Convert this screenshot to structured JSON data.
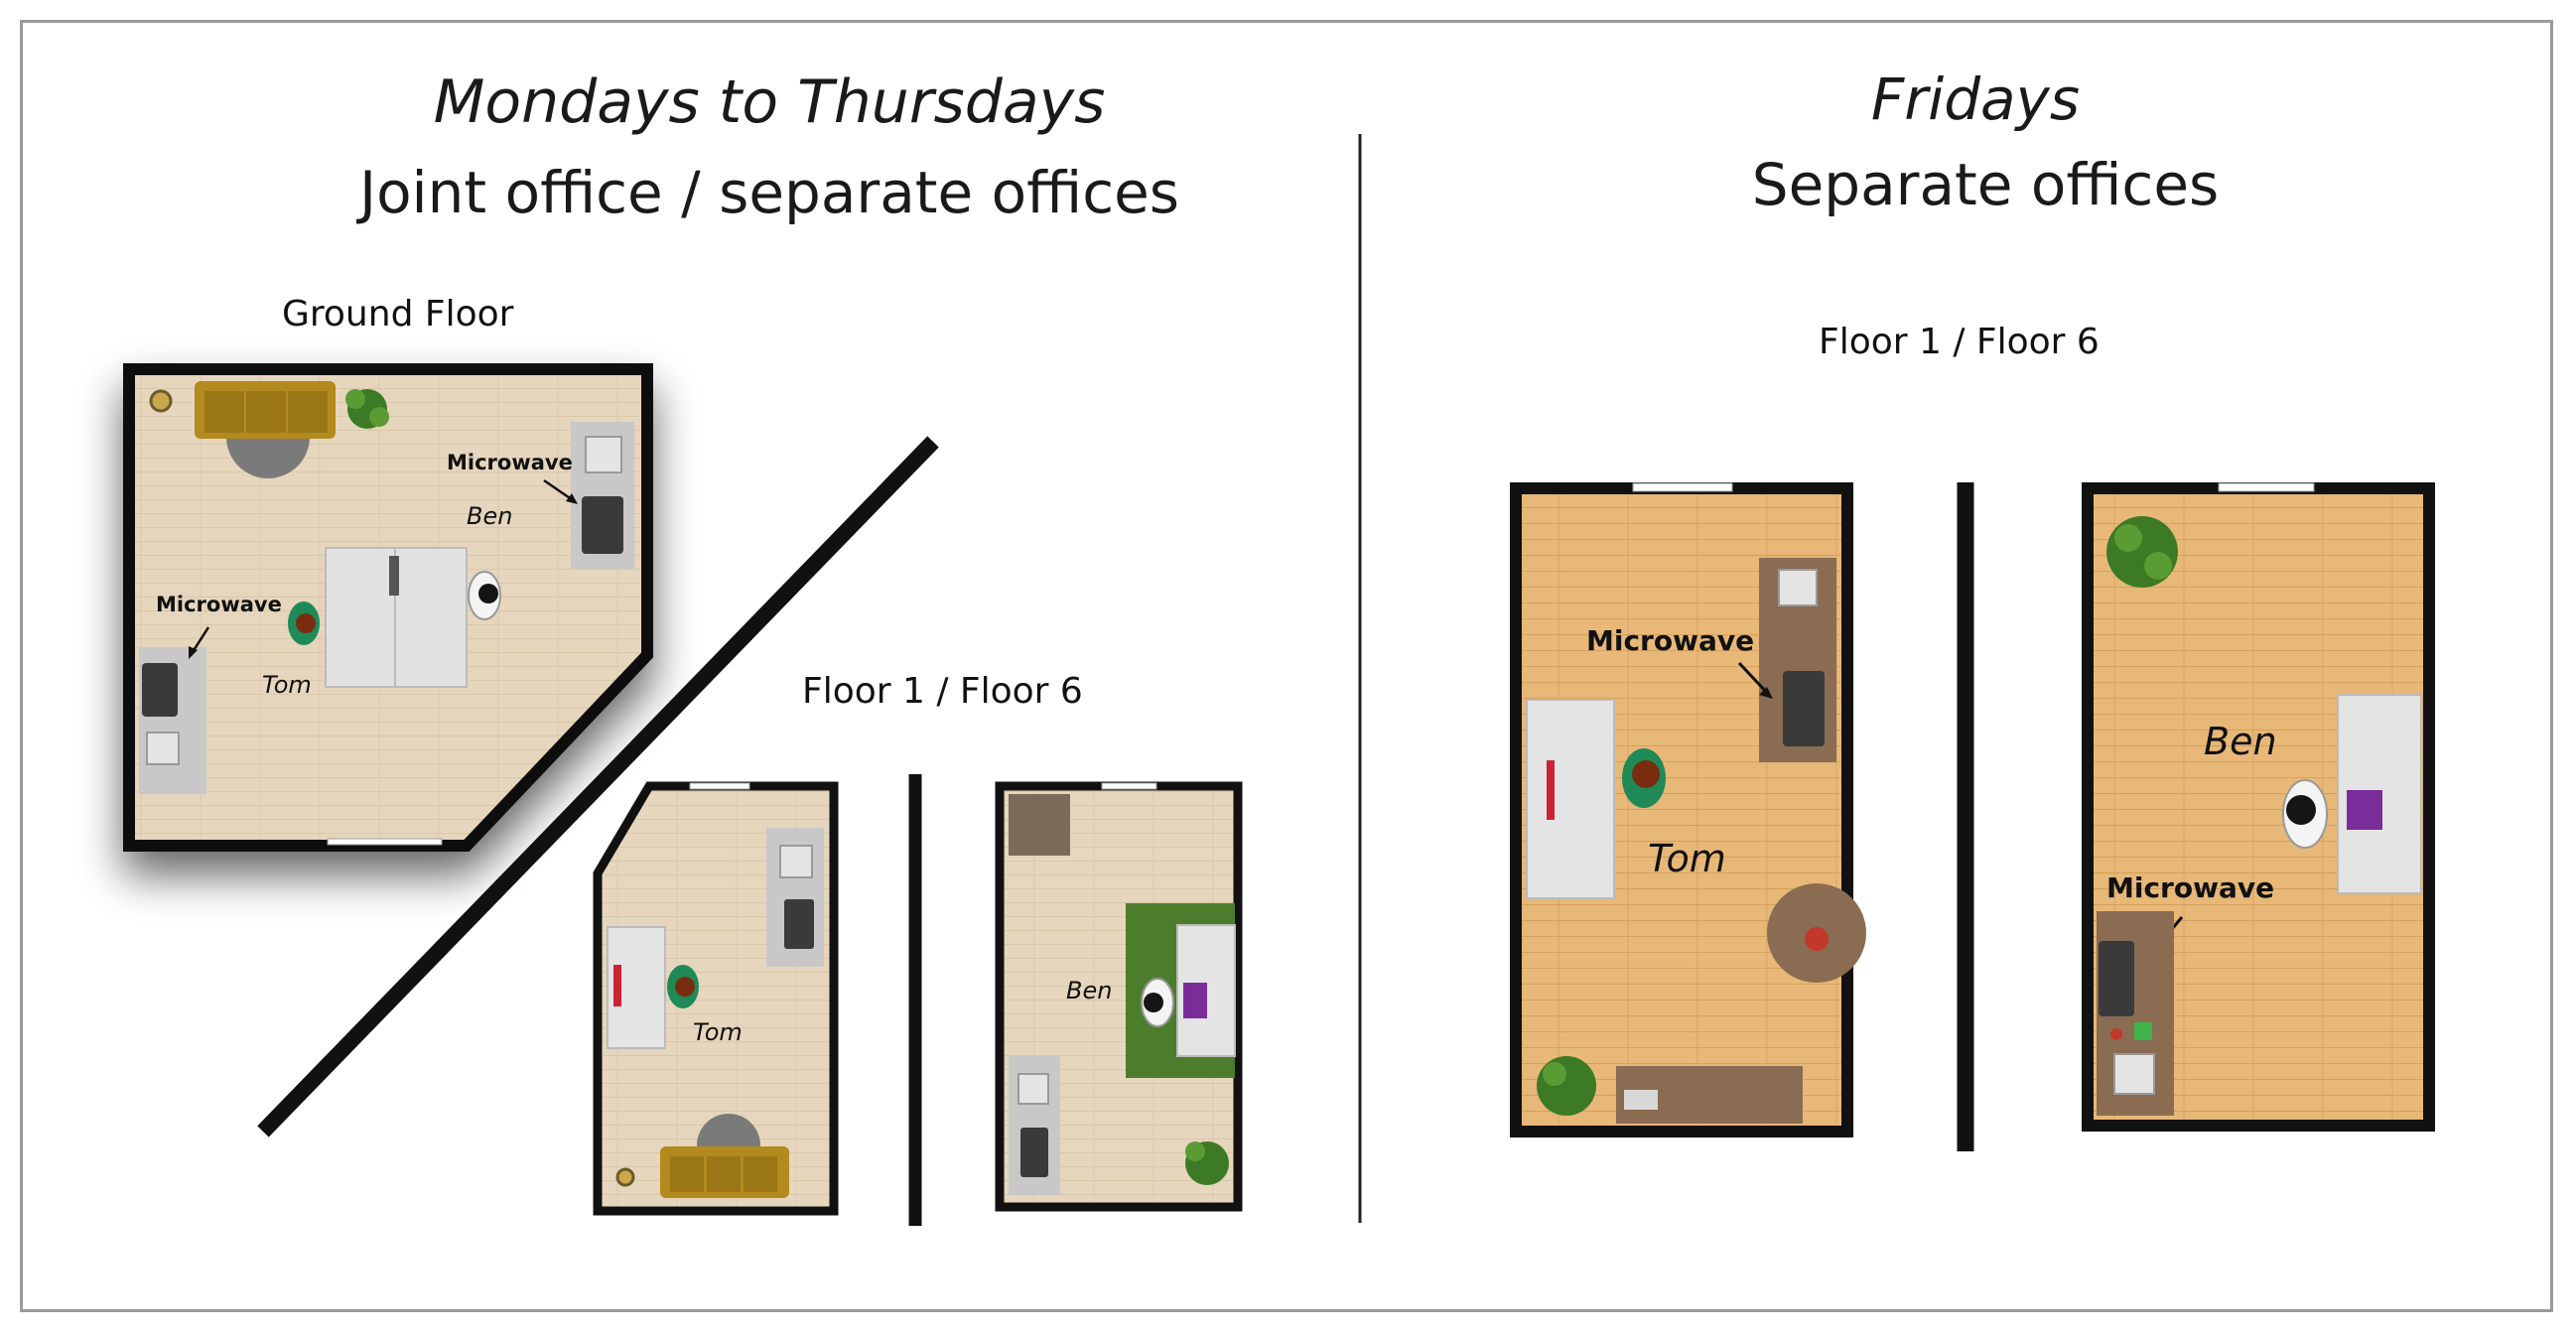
{
  "left_panel": {
    "schedule": "Mondays to Thursdays",
    "arrangement": "Joint office / separate offices",
    "ground_floor_label": "Ground Floor",
    "upper_floor_label": "Floor 1 / Floor 6",
    "ground_floor": {
      "microwave_right": "Microwave",
      "microwave_left": "Microwave",
      "person_ben": "Ben",
      "person_tom": "Tom"
    },
    "floor_tom": {
      "person": "Tom"
    },
    "floor_ben": {
      "person": "Ben"
    }
  },
  "right_panel": {
    "schedule": "Fridays",
    "arrangement": "Separate offices",
    "floor_label": "Floor 1 / Floor 6",
    "office_tom": {
      "microwave": "Microwave",
      "person": "Tom"
    },
    "office_ben": {
      "microwave": "Microwave",
      "person": "Ben"
    }
  },
  "colors": {
    "light_floor": "#e6d6bd",
    "wood_floor": "#e8b878",
    "wall": "#111111",
    "sofa": "#b28a1e",
    "rug_green": "#4c7d2c",
    "shirt_green": "#1f8a57"
  }
}
